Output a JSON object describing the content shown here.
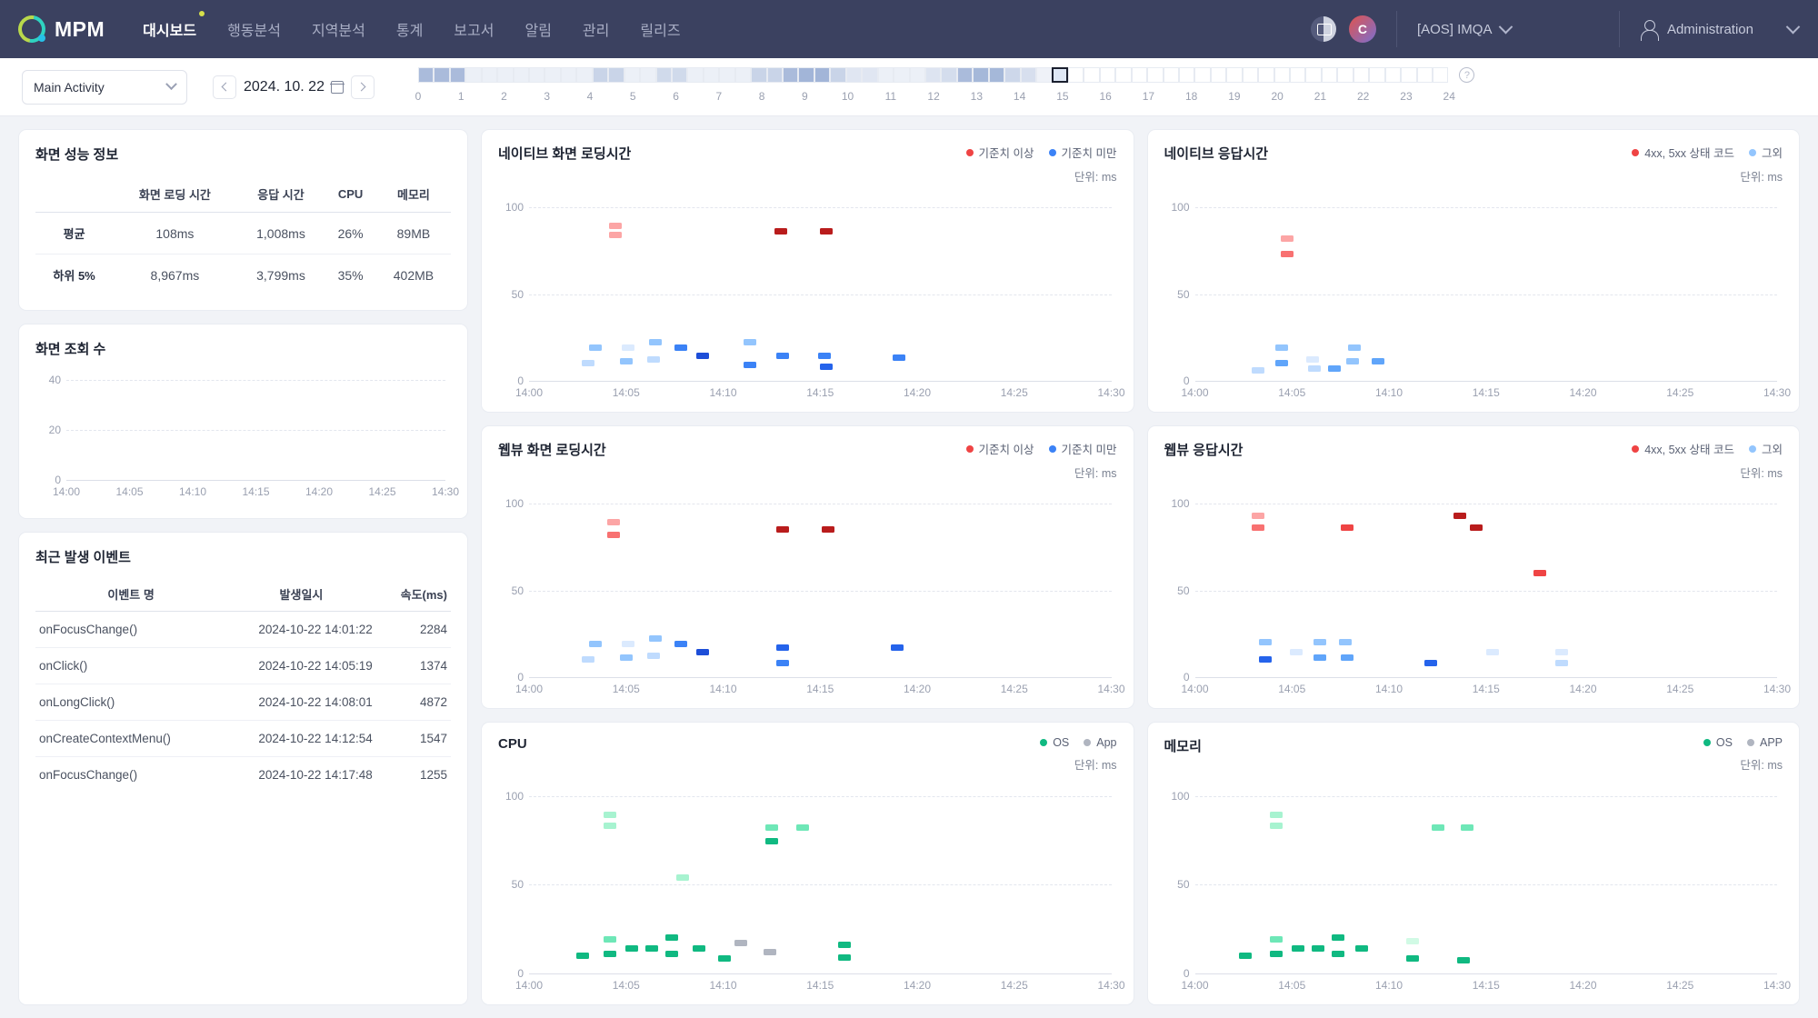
{
  "header": {
    "brand": "MPM",
    "nav": [
      {
        "label": "대시보드",
        "active": true
      },
      {
        "label": "행동분석",
        "active": false
      },
      {
        "label": "지역분석",
        "active": false
      },
      {
        "label": "통계",
        "active": false
      },
      {
        "label": "보고서",
        "active": false
      },
      {
        "label": "알림",
        "active": false
      },
      {
        "label": "관리",
        "active": false
      },
      {
        "label": "릴리즈",
        "active": false
      }
    ],
    "avatar_letter": "C",
    "project": "[AOS] IMQA",
    "user": "Administration"
  },
  "filterbar": {
    "activity": "Main Activity",
    "date": "2024. 10. 22",
    "hour_labels": [
      "0",
      "1",
      "2",
      "3",
      "4",
      "5",
      "6",
      "7",
      "8",
      "9",
      "10",
      "11",
      "12",
      "13",
      "14",
      "15",
      "16",
      "17",
      "18",
      "19",
      "20",
      "21",
      "22",
      "23",
      "24"
    ],
    "timeline_cells": [
      0.55,
      0.55,
      0.55,
      0.12,
      0.12,
      0.12,
      0.12,
      0.12,
      0.12,
      0.12,
      0.12,
      0.35,
      0.35,
      0.12,
      0.12,
      0.3,
      0.3,
      0.12,
      0.12,
      0.12,
      0.12,
      0.35,
      0.35,
      0.55,
      0.6,
      0.6,
      0.35,
      0.2,
      0.2,
      0.12,
      0.12,
      0.12,
      0.22,
      0.28,
      0.55,
      0.58,
      0.58,
      0.32,
      0.26,
      0.1
    ],
    "selected_cell_index": 40,
    "empty_cells": 24,
    "help_label": "?"
  },
  "perf_panel": {
    "title": "화면 성능 정보",
    "columns": [
      "",
      "화면 로딩 시간",
      "응답 시간",
      "CPU",
      "메모리"
    ],
    "rows": [
      {
        "label": "평균",
        "values": [
          "108ms",
          "1,008ms",
          "26%",
          "89MB"
        ]
      },
      {
        "label": "하위 5%",
        "values": [
          "8,967ms",
          "3,799ms",
          "35%",
          "402MB"
        ]
      }
    ]
  },
  "views_panel": {
    "title": "화면 조회 수"
  },
  "events_panel": {
    "title": "최근 발생 이벤트",
    "columns": [
      "이벤트 명",
      "발생일시",
      "속도(ms)"
    ],
    "rows": [
      {
        "name": "onFocusChange()",
        "time": "2024-10-22 14:01:22",
        "speed": "2284"
      },
      {
        "name": "onClick()",
        "time": "2024-10-22 14:05:19",
        "speed": "1374"
      },
      {
        "name": "onLongClick()",
        "time": "2024-10-22 14:08:01",
        "speed": "4872"
      },
      {
        "name": "onCreateContextMenu()",
        "time": "2024-10-22 14:12:54",
        "speed": "1547"
      },
      {
        "name": "onFocusChange()",
        "time": "2024-10-22 14:17:48",
        "speed": "1255"
      }
    ]
  },
  "colors": {
    "red": "#ef4444",
    "red_light": "#fca5a5",
    "red_dark": "#b91c1c",
    "blue": "#3b82f6",
    "blue_light": "#bfdbfe",
    "blue_mid": "#93c5fd",
    "green": "#10b981",
    "green_light": "#a7f3d0",
    "gray": "#b0b5c0"
  },
  "chart_data": [
    {
      "id": "native-loading",
      "type": "scatter",
      "title": "네이티브 화면 로딩시간",
      "unit": "단위: ms",
      "legend": [
        {
          "label": "기준치 이상",
          "color": "#ef4444"
        },
        {
          "label": "기준치 미만",
          "color": "#3b82f6"
        }
      ],
      "ylim": [
        0,
        110
      ],
      "yticks": [
        0,
        50,
        100
      ],
      "xticks": [
        "14:00",
        "14:05",
        "14:10",
        "14:15",
        "14:20",
        "14:25",
        "14:30"
      ],
      "xlim_minutes": [
        0,
        32
      ],
      "points": [
        {
          "t": 4.4,
          "v": 91,
          "c": "#fca5a5"
        },
        {
          "t": 4.4,
          "v": 86,
          "c": "#fca5a5"
        },
        {
          "t": 13.5,
          "v": 88,
          "c": "#b91c1c"
        },
        {
          "t": 16.0,
          "v": 88,
          "c": "#b91c1c"
        },
        {
          "t": 3.3,
          "v": 21,
          "c": "#93c5fd"
        },
        {
          "t": 2.9,
          "v": 12,
          "c": "#bfdbfe"
        },
        {
          "t": 5.1,
          "v": 21,
          "c": "#dbeafe"
        },
        {
          "t": 5.0,
          "v": 13,
          "c": "#93c5fd"
        },
        {
          "t": 6.6,
          "v": 24,
          "c": "#93c5fd"
        },
        {
          "t": 6.5,
          "v": 14,
          "c": "#bfdbfe"
        },
        {
          "t": 8.0,
          "v": 21,
          "c": "#3b82f6"
        },
        {
          "t": 9.2,
          "v": 16,
          "c": "#1d4ed8"
        },
        {
          "t": 11.8,
          "v": 24,
          "c": "#93c5fd"
        },
        {
          "t": 11.8,
          "v": 11,
          "c": "#3b82f6"
        },
        {
          "t": 13.6,
          "v": 16,
          "c": "#3b82f6"
        },
        {
          "t": 15.9,
          "v": 16,
          "c": "#3b82f6"
        },
        {
          "t": 16.0,
          "v": 10,
          "c": "#2563eb"
        },
        {
          "t": 20.0,
          "v": 15,
          "c": "#3b82f6"
        }
      ]
    },
    {
      "id": "native-response",
      "type": "scatter",
      "title": "네이티브 응답시간",
      "unit": "단위: ms",
      "legend": [
        {
          "label": "4xx, 5xx 상태 코드",
          "color": "#ef4444"
        },
        {
          "label": "그외",
          "color": "#93c5fd"
        }
      ],
      "ylim": [
        0,
        110
      ],
      "yticks": [
        0,
        50,
        100
      ],
      "xticks": [
        "14:00",
        "14:05",
        "14:10",
        "14:15",
        "14:20",
        "14:25",
        "14:30"
      ],
      "xlim_minutes": [
        0,
        32
      ],
      "points": [
        {
          "t": 4.7,
          "v": 84,
          "c": "#fca5a5"
        },
        {
          "t": 4.7,
          "v": 75,
          "c": "#f87171"
        },
        {
          "t": 3.1,
          "v": 8,
          "c": "#bfdbfe"
        },
        {
          "t": 4.4,
          "v": 21,
          "c": "#93c5fd"
        },
        {
          "t": 4.4,
          "v": 12,
          "c": "#60a5fa"
        },
        {
          "t": 6.1,
          "v": 14,
          "c": "#dbeafe"
        },
        {
          "t": 6.2,
          "v": 9,
          "c": "#bfdbfe"
        },
        {
          "t": 7.3,
          "v": 9,
          "c": "#60a5fa"
        },
        {
          "t": 8.4,
          "v": 21,
          "c": "#93c5fd"
        },
        {
          "t": 8.3,
          "v": 13,
          "c": "#93c5fd"
        },
        {
          "t": 9.7,
          "v": 13,
          "c": "#60a5fa"
        }
      ]
    },
    {
      "id": "webview-loading",
      "type": "scatter",
      "title": "웹뷰 화면 로딩시간",
      "unit": "단위: ms",
      "legend": [
        {
          "label": "기준치 이상",
          "color": "#ef4444"
        },
        {
          "label": "기준치 미만",
          "color": "#3b82f6"
        }
      ],
      "ylim": [
        0,
        110
      ],
      "yticks": [
        0,
        50,
        100
      ],
      "xticks": [
        "14:00",
        "14:05",
        "14:10",
        "14:15",
        "14:20",
        "14:25",
        "14:30"
      ],
      "xlim_minutes": [
        0,
        32
      ],
      "points": [
        {
          "t": 4.3,
          "v": 91,
          "c": "#fca5a5"
        },
        {
          "t": 4.3,
          "v": 84,
          "c": "#f87171"
        },
        {
          "t": 13.6,
          "v": 87,
          "c": "#b91c1c"
        },
        {
          "t": 16.1,
          "v": 87,
          "c": "#b91c1c"
        },
        {
          "t": 3.3,
          "v": 21,
          "c": "#93c5fd"
        },
        {
          "t": 2.9,
          "v": 12,
          "c": "#bfdbfe"
        },
        {
          "t": 5.1,
          "v": 21,
          "c": "#dbeafe"
        },
        {
          "t": 5.0,
          "v": 13,
          "c": "#93c5fd"
        },
        {
          "t": 6.6,
          "v": 24,
          "c": "#93c5fd"
        },
        {
          "t": 6.5,
          "v": 14,
          "c": "#bfdbfe"
        },
        {
          "t": 8.0,
          "v": 21,
          "c": "#3b82f6"
        },
        {
          "t": 9.2,
          "v": 16,
          "c": "#1d4ed8"
        },
        {
          "t": 13.6,
          "v": 19,
          "c": "#2563eb"
        },
        {
          "t": 13.6,
          "v": 10,
          "c": "#3b82f6"
        },
        {
          "t": 19.9,
          "v": 19,
          "c": "#2563eb"
        }
      ]
    },
    {
      "id": "webview-response",
      "type": "scatter",
      "title": "웹뷰 응답시간",
      "unit": "단위: ms",
      "legend": [
        {
          "label": "4xx, 5xx 상태 코드",
          "color": "#ef4444"
        },
        {
          "label": "그외",
          "color": "#93c5fd"
        }
      ],
      "ylim": [
        0,
        110
      ],
      "yticks": [
        0,
        50,
        100
      ],
      "xticks": [
        "14:00",
        "14:05",
        "14:10",
        "14:15",
        "14:20",
        "14:25",
        "14:30"
      ],
      "xlim_minutes": [
        0,
        32
      ],
      "points": [
        {
          "t": 3.1,
          "v": 95,
          "c": "#fca5a5"
        },
        {
          "t": 3.1,
          "v": 88,
          "c": "#f87171"
        },
        {
          "t": 8.0,
          "v": 88,
          "c": "#ef4444"
        },
        {
          "t": 14.2,
          "v": 95,
          "c": "#b91c1c"
        },
        {
          "t": 15.1,
          "v": 88,
          "c": "#b91c1c"
        },
        {
          "t": 18.6,
          "v": 62,
          "c": "#ef4444"
        },
        {
          "t": 3.5,
          "v": 22,
          "c": "#93c5fd"
        },
        {
          "t": 3.5,
          "v": 12,
          "c": "#2563eb"
        },
        {
          "t": 5.2,
          "v": 16,
          "c": "#dbeafe"
        },
        {
          "t": 6.5,
          "v": 22,
          "c": "#93c5fd"
        },
        {
          "t": 6.5,
          "v": 13,
          "c": "#60a5fa"
        },
        {
          "t": 7.9,
          "v": 22,
          "c": "#93c5fd"
        },
        {
          "t": 8.0,
          "v": 13,
          "c": "#60a5fa"
        },
        {
          "t": 12.6,
          "v": 10,
          "c": "#2563eb"
        },
        {
          "t": 16.0,
          "v": 16,
          "c": "#dbeafe"
        },
        {
          "t": 19.8,
          "v": 16,
          "c": "#dbeafe"
        },
        {
          "t": 19.8,
          "v": 10,
          "c": "#bfdbfe"
        }
      ]
    },
    {
      "id": "cpu",
      "type": "scatter",
      "title": "CPU",
      "unit": "단위: ms",
      "legend": [
        {
          "label": "OS",
          "color": "#10b981"
        },
        {
          "label": "App",
          "color": "#b0b5c0"
        }
      ],
      "ylim": [
        0,
        110
      ],
      "yticks": [
        0,
        50,
        100
      ],
      "xticks": [
        "14:00",
        "14:05",
        "14:10",
        "14:15",
        "14:20",
        "14:25",
        "14:30"
      ],
      "xlim_minutes": [
        0,
        32
      ],
      "points": [
        {
          "t": 4.1,
          "v": 91,
          "c": "#a7f3d0"
        },
        {
          "t": 4.1,
          "v": 85,
          "c": "#a7f3d0"
        },
        {
          "t": 8.1,
          "v": 56,
          "c": "#a7f3d0"
        },
        {
          "t": 13.0,
          "v": 84,
          "c": "#6ee7b7"
        },
        {
          "t": 13.0,
          "v": 76,
          "c": "#10b981"
        },
        {
          "t": 14.7,
          "v": 84,
          "c": "#6ee7b7"
        },
        {
          "t": 2.6,
          "v": 12,
          "c": "#10b981"
        },
        {
          "t": 4.1,
          "v": 21,
          "c": "#6ee7b7"
        },
        {
          "t": 4.1,
          "v": 13,
          "c": "#10b981"
        },
        {
          "t": 5.3,
          "v": 16,
          "c": "#10b981"
        },
        {
          "t": 6.4,
          "v": 16,
          "c": "#10b981"
        },
        {
          "t": 7.5,
          "v": 22,
          "c": "#10b981"
        },
        {
          "t": 7.5,
          "v": 13,
          "c": "#10b981"
        },
        {
          "t": 9.0,
          "v": 16,
          "c": "#10b981"
        },
        {
          "t": 10.4,
          "v": 10,
          "c": "#10b981"
        },
        {
          "t": 11.3,
          "v": 19,
          "c": "#b0b5c0"
        },
        {
          "t": 12.9,
          "v": 14,
          "c": "#b0b5c0"
        },
        {
          "t": 17.0,
          "v": 18,
          "c": "#10b981"
        },
        {
          "t": 17.0,
          "v": 11,
          "c": "#10b981"
        }
      ]
    },
    {
      "id": "memory",
      "type": "scatter",
      "title": "메모리",
      "unit": "단위: ms",
      "legend": [
        {
          "label": "OS",
          "color": "#10b981"
        },
        {
          "label": "APP",
          "color": "#b0b5c0"
        }
      ],
      "ylim": [
        0,
        110
      ],
      "yticks": [
        0,
        50,
        100
      ],
      "xticks": [
        "14:00",
        "14:05",
        "14:10",
        "14:15",
        "14:20",
        "14:25",
        "14:30"
      ],
      "xlim_minutes": [
        0,
        32
      ],
      "points": [
        {
          "t": 4.1,
          "v": 91,
          "c": "#a7f3d0"
        },
        {
          "t": 4.1,
          "v": 85,
          "c": "#a7f3d0"
        },
        {
          "t": 13.0,
          "v": 84,
          "c": "#6ee7b7"
        },
        {
          "t": 14.6,
          "v": 84,
          "c": "#6ee7b7"
        },
        {
          "t": 2.4,
          "v": 12,
          "c": "#10b981"
        },
        {
          "t": 4.1,
          "v": 21,
          "c": "#6ee7b7"
        },
        {
          "t": 4.1,
          "v": 13,
          "c": "#10b981"
        },
        {
          "t": 5.3,
          "v": 16,
          "c": "#10b981"
        },
        {
          "t": 6.4,
          "v": 16,
          "c": "#10b981"
        },
        {
          "t": 7.5,
          "v": 22,
          "c": "#10b981"
        },
        {
          "t": 7.5,
          "v": 13,
          "c": "#10b981"
        },
        {
          "t": 8.8,
          "v": 16,
          "c": "#10b981"
        },
        {
          "t": 11.6,
          "v": 20,
          "c": "#d1fae5"
        },
        {
          "t": 11.6,
          "v": 10,
          "c": "#10b981"
        },
        {
          "t": 14.4,
          "v": 9,
          "c": "#10b981"
        }
      ]
    }
  ],
  "views_chart": {
    "type": "line",
    "title": "화면 조회 수",
    "yticks": [
      0,
      20,
      40
    ],
    "ylim": [
      0,
      45
    ],
    "xticks": [
      "14:00",
      "14:05",
      "14:10",
      "14:15",
      "14:20",
      "14:25",
      "14:30"
    ],
    "values": []
  }
}
